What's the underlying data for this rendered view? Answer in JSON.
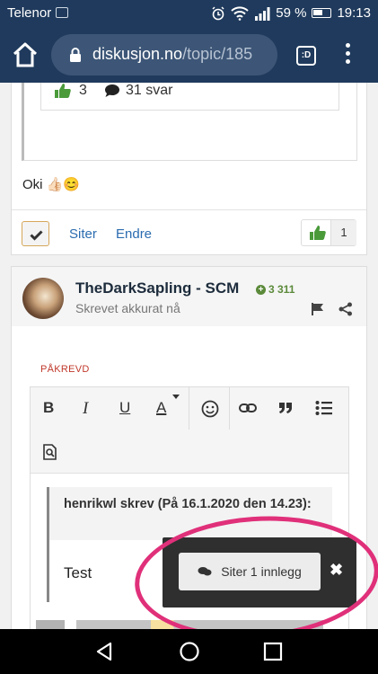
{
  "statusbar": {
    "carrier": "Telenor",
    "battery": "59 %",
    "time": "19:13"
  },
  "browser": {
    "url_host": "diskusjon.no",
    "url_path": "/topic/185",
    "tab_icon_text": ":D"
  },
  "post1": {
    "embed_likes": "3",
    "embed_replies": "31 svar",
    "text": "Oki 👍🏻😊",
    "cite_label": "Siter",
    "edit_label": "Endre",
    "like_count": "1"
  },
  "post2": {
    "author": "TheDarkSapling - SCM",
    "reputation": "3 311",
    "posted": "Skrevet akkurat nå",
    "required_label": "PÅKREVD",
    "toolbar": {
      "bold": "B",
      "italic": "I",
      "underline": "U",
      "color": "A"
    },
    "quote": {
      "header": "henrikwl skrev (På 16.1.2020 den 14.23):",
      "body": "Test"
    }
  },
  "cite_popup": {
    "label": "Siter 1 innlegg",
    "close": "✖"
  },
  "colors": {
    "header_bg": "#1f3a5c",
    "url_box_bg": "#3d5677",
    "link": "#2b6cb0",
    "reputation": "#5b8a3a",
    "required": "#c0392b",
    "annotation": "#e0307a"
  }
}
